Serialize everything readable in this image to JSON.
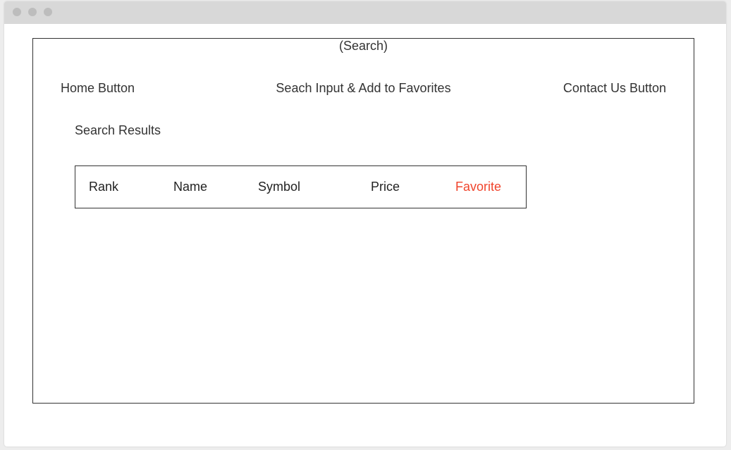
{
  "page": {
    "title": "(Search)"
  },
  "nav": {
    "home": "Home Button",
    "search_favorites": "Seach Input & Add to Favorites",
    "contact": "Contact Us Button"
  },
  "results": {
    "heading": "Search Results",
    "columns": [
      "Rank",
      "Name",
      "Symbol",
      "Price",
      "Favorite"
    ],
    "favorite_color": "#f0442c"
  }
}
